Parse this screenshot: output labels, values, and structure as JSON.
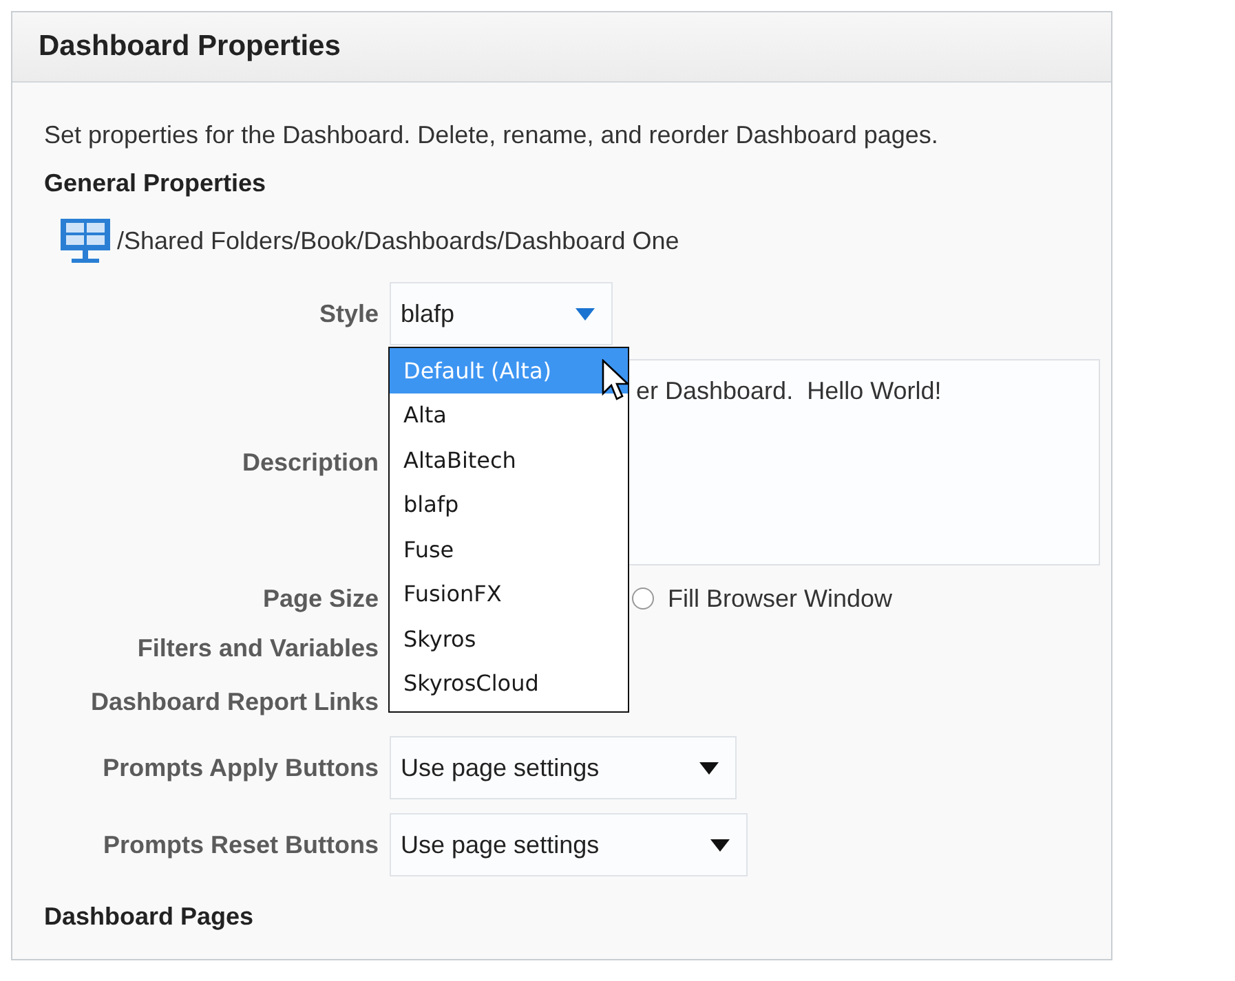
{
  "panel": {
    "title": "Dashboard Properties"
  },
  "intro": "Set properties for the Dashboard. Delete, rename, and reorder Dashboard pages.",
  "general_heading": "General Properties",
  "path": "/Shared Folders/Book/Dashboards/Dashboard One",
  "style": {
    "label": "Style",
    "value": "blafp",
    "expanded": true,
    "options": [
      {
        "label": "Default (Alta)",
        "highlighted": true
      },
      {
        "label": "Alta",
        "highlighted": false
      },
      {
        "label": "AltaBitech",
        "highlighted": false
      },
      {
        "label": "blafp",
        "highlighted": false
      },
      {
        "label": "Fuse",
        "highlighted": false
      },
      {
        "label": "FusionFX",
        "highlighted": false
      },
      {
        "label": "Skyros",
        "highlighted": false
      },
      {
        "label": "SkyrosCloud",
        "highlighted": false
      }
    ]
  },
  "description": {
    "label": "Description",
    "value": "er Dashboard.  Hello World!"
  },
  "page_size": {
    "label": "Page Size",
    "option": "Fill Browser Window",
    "selected": false
  },
  "filters_label": "Filters and Variables",
  "report_links_label": "Dashboard Report Links",
  "prompts": [
    {
      "label": "Prompts Apply Buttons",
      "value": "Use page settings"
    },
    {
      "label": "Prompts Reset Buttons",
      "value": "Use page settings"
    }
  ],
  "pages_heading": "Dashboard Pages"
}
